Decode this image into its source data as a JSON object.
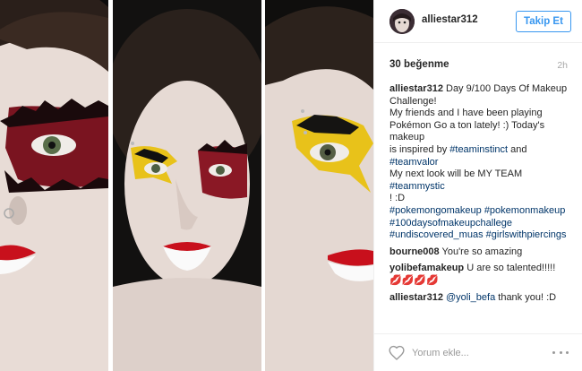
{
  "post": {
    "username": "alliestar312",
    "follow_label": "Takip Et",
    "likes": "30 beğenme",
    "time": "2h",
    "caption_lines": [
      "Day 9/100 Days Of Makeup",
      "Challenge!",
      "My friends and I have been playing",
      "Pokémon Go a ton lately! :) Today's makeup",
      "is inspired by",
      "#teaminstinct",
      "and",
      "#teamvalor",
      "My next look will be MY TEAM",
      "#teammystic",
      "! :D",
      "#pokemongomakeup",
      "#pokemonmakeup",
      "#100daysofmakeupchallege",
      "#undiscovered_muas",
      "#girlswithpiercings"
    ],
    "comments": [
      {
        "user": "bourne008",
        "text": "You're so amazing"
      },
      {
        "user": "yolibefamakeup",
        "text": "U are so talented!!!!!",
        "emoji": "💋💋💋💋"
      },
      {
        "user": "alliestar312",
        "mention": "@yoli_befa",
        "text": "thank you! :D"
      }
    ],
    "comment_placeholder": "Yorum ekle...",
    "colors": {
      "accent": "#3897f0",
      "hashtag": "#003569"
    }
  }
}
